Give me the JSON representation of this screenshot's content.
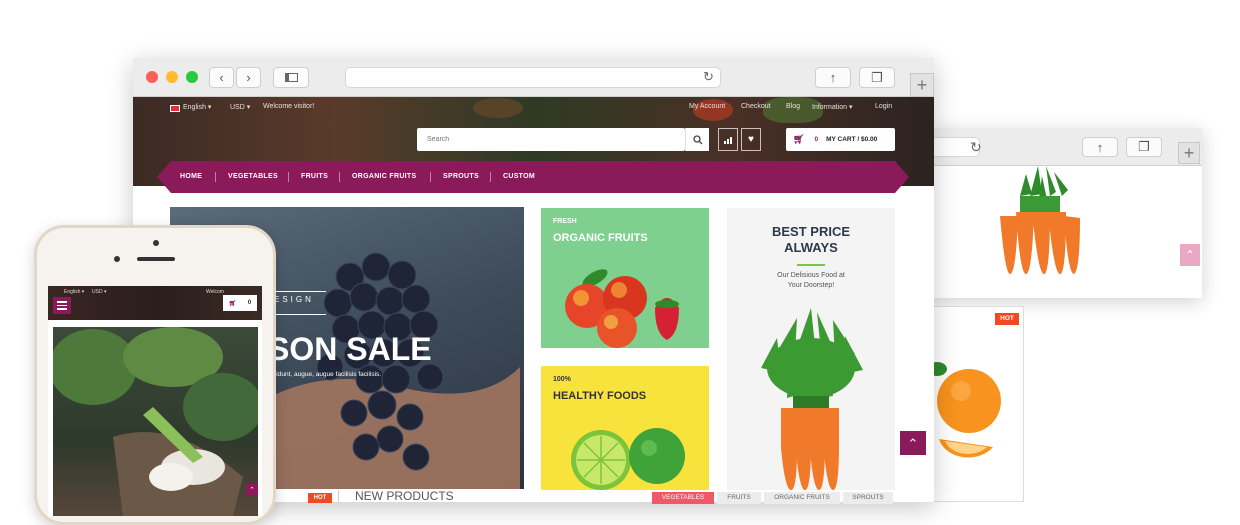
{
  "main_site": {
    "topbar": {
      "language": "English",
      "currency": "USD",
      "welcome": "Welcome visitor!",
      "links": [
        "My Account",
        "Checkout",
        "Blog",
        "Information",
        "Login"
      ]
    },
    "search": {
      "placeholder": "Search"
    },
    "cart": {
      "count": "0",
      "label": "MY CART / $0.00"
    },
    "nav": [
      "HOME",
      "VEGETABLES",
      "FRUITS",
      "ORGANIC FRUITS",
      "SPROUTS",
      "CUSTOM"
    ],
    "slider": {
      "eyebrow": "ESIGN",
      "headline": "SON SALE",
      "text": "incidunt, augue, augue facilisis facilisis."
    },
    "promo1": {
      "small": "FRESH",
      "title": "ORGANIC FRUITS"
    },
    "promo2": {
      "small": "100%",
      "title": "HEALTHY FOODS"
    },
    "promo3": {
      "title_line1": "BEST PRICE",
      "title_line2": "ALWAYS",
      "sub_line1": "Our Delisious Food at",
      "sub_line2": "Your Doorstep!"
    },
    "products": {
      "hot_badge": "HOT",
      "heading": "NEW PRODUCTS",
      "tabs": [
        "VEGETABLES",
        "FRUITS",
        "ORGANIC FRUITS",
        "SPROUTS"
      ]
    }
  },
  "back_site": {
    "hot_badge": "HOT"
  },
  "phone": {
    "language": "English",
    "currency": "USD",
    "welcome": "Welcom",
    "cart_count": "0"
  },
  "colors": {
    "brand": "#8b1a5a",
    "hot": "#f04a24",
    "green_card": "#7fcf8f",
    "yellow_card": "#f8e33d"
  }
}
